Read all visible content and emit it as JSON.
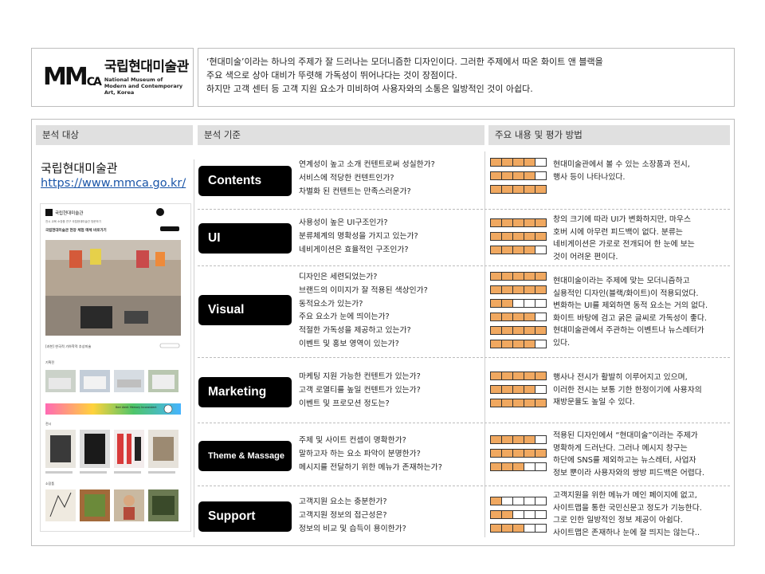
{
  "logo": {
    "mark_main": "MM",
    "mark_sub": "CA",
    "name_kr": "국립현대미술관",
    "name_en_1": "National Museum of",
    "name_en_2": "Modern and Contemporary Art, Korea"
  },
  "summary": [
    "‘현대미술’이라는 하나의 주제가 잘 드러나는 모더니즘한 디자인이다. 그러한 주제에서 따온 화이트 앤 블랙을",
    "주요 색으로 상아 대비가 뚜렷해 가독성이 뛰어나다는 것이 장점이다.",
    "하지만 고객 센터 등 고객 지원 요소가 미비하여 사용자와의 소통은 일방적인 것이 아쉽다."
  ],
  "headers": {
    "target": "분석 대상",
    "criteria": "분석 기준",
    "evaluation": "주요 내용 및 평가 방법"
  },
  "target": {
    "name": "국립현대미술관",
    "url": "https://www.mmca.go.kr/"
  },
  "thumb": {
    "logo": "국립현대미술관",
    "nav": "전시 교육 소장품 연구 국립현대미술관 방문하기",
    "headline": "국립현대미술관 현장 체험 매체 바로가기",
    "caption": "[과천] 한국적 기하학적 추상미술",
    "section1": "기획전",
    "band": "Bani Abidi: Memory Inconsistent",
    "section2": "전시",
    "section3": "소장품",
    "colors": {
      "accent": "#111111",
      "band1": "#ff6ab4",
      "band2": "#ffd23c",
      "band3": "#46b4ff"
    }
  },
  "rows": [
    {
      "label": "Contents",
      "small": false,
      "criteria": [
        "연계성이 높고 소개 컨텐트로써 성실한가?",
        "서비스에 적당한 컨텐트인가?",
        "차별화 된 컨텐트는 만족스러운가?"
      ],
      "ratings": [
        4,
        4,
        5
      ],
      "desc": [
        "현대미술관에서 볼 수 있는 소장품과 전시,",
        "행사 등이 나타나있다."
      ]
    },
    {
      "label": "UI",
      "small": false,
      "criteria": [
        "사용성이 높은 UI구조인가?",
        "분류체계의 명확성을 가지고 있는가?",
        "네비게이션은 효율적인 구조인가?"
      ],
      "ratings": [
        5,
        5,
        4
      ],
      "desc": [
        "창의 크기에 따라 UI가 변화하지만, 마우스",
        "호버 시에 아무런 피드백이 없다. 분류는",
        "네비게이션은 가로로 전개되어 한 눈에 보는",
        "것이 어려운 편이다."
      ]
    },
    {
      "label": "Visual",
      "small": false,
      "criteria": [
        "디자인은 세련되었는가?",
        "브랜드의 이미지가 잘 적용된 색상인가?",
        "동적요소가 있는가?",
        "주요 요소가 눈에 띄이는가?",
        "적절한 가독성을 제공하고 있는가?",
        "이벤트 및 홍보 영역이 있는가?"
      ],
      "ratings": [
        5,
        5,
        2,
        4,
        5,
        4
      ],
      "desc": [
        "현대미술이라는 주제에 맞는 모더니즘하고",
        "실용적인 디자인(블랙/화이트)이 적용되었다.",
        "변화하는 UI를 제외하면 동적 요소는 거의 없다.",
        "화이트 바탕에 검고 굵은 글씨로 가독성이 좋다.",
        "현대미술관에서 주관하는 이벤트나 뉴스레터가",
        "있다."
      ]
    },
    {
      "label": "Marketing",
      "small": false,
      "criteria": [
        "마케팅 지원 가능한 컨텐트가 있는가?",
        "고객 로열티를 높일 컨텐트가 있는가?",
        "이벤트 및 프로모션 정도는?"
      ],
      "ratings": [
        5,
        4,
        5
      ],
      "desc": [
        "행사나 전시가 활발히 이루어지고 있으며,",
        "이러한 전시는 보통 기한 한정이기에 사용자의",
        "재방문율도 높일 수 있다."
      ]
    },
    {
      "label": "Theme & Massage",
      "small": true,
      "criteria": [
        "주제 및 사이트 컨셉이 명확한가?",
        "말하고자 하는 요소 파악이 분명한가?",
        "메시지를 전달하기 위한 메뉴가 존재하는가?"
      ],
      "ratings": [
        4,
        5,
        3
      ],
      "desc": [
        "적용된 디자인에서 “현대미술”이라는 주제가",
        "명확하게 드러난다. 그러나 메시지 창구는",
        "하단에 SNS를 제외하고는 뉴스레터, 사업자",
        "정보 뿐이라 사용자와의 쌍방 피드백은 어렵다."
      ]
    },
    {
      "label": "Support",
      "small": false,
      "criteria": [
        "고객지원 요소는 충분한가?",
        "고객지원 정보의 접근성은?",
        "정보의 비교 및 습득이 용이한가?"
      ],
      "ratings": [
        1,
        2,
        3
      ],
      "desc": [
        "고객지원을 위한 메뉴가 메인 페이지에 없고,",
        "사이트맵을 통한 국민신문고 정도가 기능한다.",
        "그로 인한 일방적인 정보 제공이 아쉽다.",
        "사이트맵은 존재하나 눈에 잘 띄지는 않는다.."
      ]
    }
  ],
  "colors": {
    "rating_fill": "#f0a860",
    "pill": "#000000",
    "header_bg": "#e0e0e0",
    "link": "#1a55a8"
  }
}
